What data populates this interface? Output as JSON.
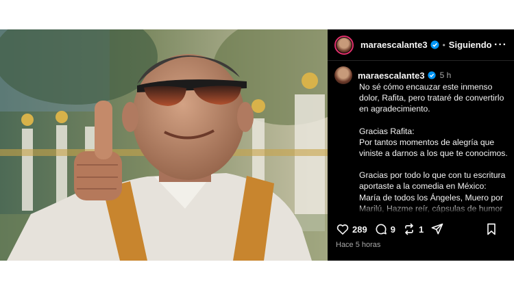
{
  "post": {
    "username": "maraescalante3",
    "follow_status": "Siguiendo",
    "separator": "•",
    "more_label": "···",
    "caption": {
      "username": "maraescalante3",
      "time": "5 h",
      "paragraphs": [
        "No sé cómo encauzar este inmenso dolor, Rafita, pero trataré de convertirlo en agradecimiento.",
        "Gracias Rafita:\nPor tantos momentos de alegría que viniste a darnos a los que te conocimos.",
        "Gracias por todo lo que con tu escritura aportaste a la comedia en México: María de todos los Ángeles, Muero por Marilú, Hazme reír, cápsulas de humor para Sudáfrica, China, Tokyo. etc, etc; etc. Gracias por haber sido nuestra tutora..."
      ]
    },
    "counts": {
      "likes": "289",
      "comments": "9",
      "reposts": "1"
    },
    "posted": "Hace 5 horas"
  },
  "colors": {
    "verified": "#0095f6",
    "story_ring": "#e1306c",
    "background": "#000000"
  },
  "icons": [
    "heart-icon",
    "comment-icon",
    "repost-icon",
    "share-icon",
    "bookmark-icon",
    "verified-badge-icon"
  ]
}
